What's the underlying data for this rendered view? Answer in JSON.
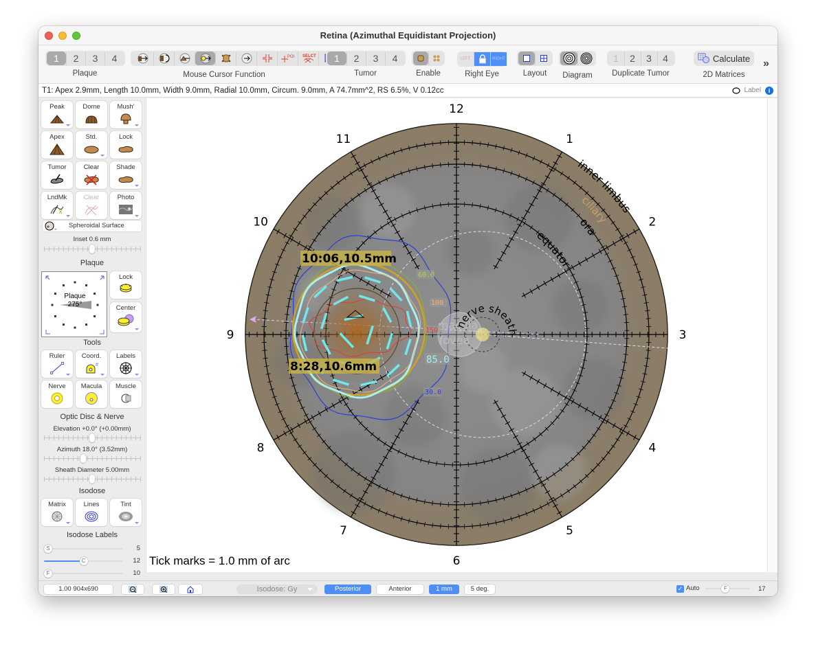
{
  "window": {
    "title": "Retina (Azimuthal Equidistant Projection)"
  },
  "toolbar": {
    "plaque": {
      "label": "Plaque",
      "options": [
        "1",
        "2",
        "3",
        "4"
      ],
      "selected": "1"
    },
    "mouse_cursor": {
      "label": "Mouse Cursor Function",
      "tools": [
        "move-plaque-icon",
        "rotate-plaque-icon",
        "move-tumor-icon",
        "move-point-icon",
        "resize-plaque-icon",
        "move-view-icon",
        "crosshair-icon",
        "poi-icon",
        "select-icon",
        "pointer-icon"
      ],
      "selected_index": 3,
      "poi_text": "POI",
      "select_text": "SELCT"
    },
    "tumor": {
      "label": "Tumor",
      "options": [
        "1",
        "2",
        "3",
        "4"
      ],
      "selected": "1"
    },
    "enable": {
      "label": "Enable"
    },
    "eye": {
      "label": "Right Eye",
      "left": "LEFT",
      "right": "RIGHT"
    },
    "layout": {
      "label": "Layout"
    },
    "diagram": {
      "label": "Diagram"
    },
    "duplicate_tumor": {
      "label": "Duplicate Tumor",
      "options": [
        "1",
        "2",
        "3",
        "4"
      ]
    },
    "matrices": {
      "button": "Calculate",
      "label": "2D Matrices"
    },
    "overflow": "»"
  },
  "infobar": {
    "text": "T1: Apex 2.9mm, Length 10.0mm, Width 9.0mm, Radial 10.0mm, Circum. 9.0mm, A 74.7mm^2, RS 6.5%, V 0.12cc",
    "label_toggle": "Label",
    "info": "i"
  },
  "sidebar": {
    "shape_buttons": [
      {
        "label": "Peak",
        "icon": "peak-tumor-icon",
        "menu": true
      },
      {
        "label": "Dome",
        "icon": "dome-tumor-icon",
        "menu": false
      },
      {
        "label": "Mush'",
        "icon": "mushroom-tumor-icon",
        "menu": true
      },
      {
        "label": "Apex",
        "icon": "apex-tumor-icon",
        "menu": false
      },
      {
        "label": "Std.",
        "icon": "standard-base-icon",
        "menu": true
      },
      {
        "label": "Lock",
        "icon": "lock-base-icon",
        "menu": false
      },
      {
        "label": "Tumor",
        "icon": "tumor-draw-icon",
        "menu": false
      },
      {
        "label": "Clear",
        "icon": "clear-tumor-icon",
        "menu": false
      },
      {
        "label": "Shade",
        "icon": "shade-icon",
        "menu": true
      },
      {
        "label": "LndMk",
        "icon": "landmark-icon",
        "menu": true
      },
      {
        "label": "Clear",
        "icon": "clear-landmark-icon",
        "menu": false,
        "disabled": true
      },
      {
        "label": "Photo",
        "icon": "photo-icon",
        "menu": true
      }
    ],
    "surface": "Spheroidal Surface",
    "inset": "Inset 0.6 mm",
    "inset_value": 0.5,
    "plaque_section": "Plaque",
    "plaque_dial": {
      "label": "Plaque",
      "angle": "275°"
    },
    "plaque_lock": "Lock",
    "plaque_center": "Center",
    "tools_section": "Tools",
    "tools": [
      {
        "label": "Ruler",
        "icon": "ruler-icon"
      },
      {
        "label": "Coord.",
        "icon": "coordinate-icon"
      },
      {
        "label": "Labels",
        "icon": "labels-icon"
      },
      {
        "label": "Nerve",
        "icon": "nerve-icon"
      },
      {
        "label": "Macula",
        "icon": "macula-icon"
      },
      {
        "label": "Muscle",
        "icon": "muscle-icon"
      }
    ],
    "optic_section": "Optic Disc & Nerve",
    "elevation": "Elevation +0.0° (+0.00mm)",
    "elevation_value": 0.5,
    "azimuth": "Azimuth 18.0° (3.52mm)",
    "azimuth_value": 0.4,
    "sheath": "Sheath Diameter 5.00mm",
    "sheath_value": 0.5,
    "isodose_section": "Isodose",
    "isodose_buttons": [
      {
        "label": "Matrix",
        "icon": "matrix-icon"
      },
      {
        "label": "Lines",
        "icon": "lines-icon"
      },
      {
        "label": "Tint",
        "icon": "tint-icon"
      }
    ],
    "isodose_labels_section": "Isodose Labels",
    "label_sliders": [
      {
        "knob": "S",
        "value": "5",
        "fraction": 0.0
      },
      {
        "knob": "C",
        "value": "12",
        "fraction": 0.5
      },
      {
        "knob": "F",
        "value": "10",
        "fraction": 0.0
      }
    ]
  },
  "diagram": {
    "clock_hours": [
      "12",
      "1",
      "2",
      "3",
      "4",
      "5",
      "6",
      "7",
      "8",
      "9",
      "10",
      "11"
    ],
    "ring_labels": {
      "limbus": "inner limbus",
      "ciliary": "ciliary",
      "ora": "ora",
      "equator": "equator"
    },
    "nerve_label": "nerve sheath",
    "macula_label": "macula",
    "fovea_label": "fovea",
    "tumor_margin_labels": [
      "10:06,10.5mm",
      "8:28,10.6mm"
    ],
    "isodose_labels": [
      {
        "value": "60.0",
        "color": "#b4d235"
      },
      {
        "value": "100",
        "color": "#f4b27a"
      },
      {
        "value": "150",
        "color": "#e03c2c"
      },
      {
        "value": "85.0",
        "color": "#a8f0ee"
      },
      {
        "value": "30.0",
        "color": "#2b3fd6"
      }
    ],
    "tick_note": "Tick marks = 1.0 mm of arc"
  },
  "statusbar": {
    "zoom": "1.00 904x690",
    "isodose_select": "Isodose: Gy",
    "posterior": "Posterior",
    "anterior": "Anterior",
    "grid_mm": "1 mm",
    "grid_deg": "5 deg.",
    "auto_label": "Auto",
    "auto_checked": true,
    "f_knob": "F",
    "f_value": "17",
    "f_fraction": 0.45
  }
}
